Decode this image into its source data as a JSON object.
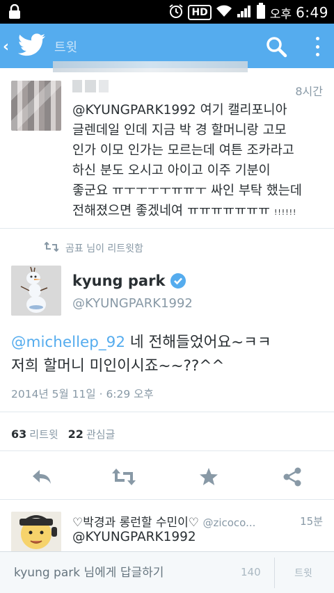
{
  "status_bar": {
    "ampm": "오후",
    "time": "6:49",
    "hd_label": "HD"
  },
  "app_bar": {
    "title": "트윗",
    "icons": [
      "back-arrow-icon",
      "twitter-bird-icon",
      "search-icon",
      "more-vert-icon"
    ],
    "color": "#55acee"
  },
  "tweet1": {
    "time": "8시간",
    "lines": [
      "@KYUNGPARK1992 여기 캘리포니아",
      "글렌데일 인데 지금 박 경 할머니랑 고모",
      "인가 이모 인가는 모르는데 여튼 조카라고",
      "하신 분도 오시고 아이고 이주 기분이",
      "좋군요 ㅠㅜㅜㅜㅜㅠㅠㅜ 싸인 부탁 했는데"
    ],
    "last_line": "전해졌으면 좋겠네여 ㅠㅠㅠㅠㅠㅠㅠ",
    "last_line_suffix": "!!!!!!"
  },
  "retweet_context": {
    "text": "곰표 님이 리트윗함"
  },
  "main_tweet": {
    "name": "kyung park",
    "handle": "@KYUNGPARK1992",
    "mention": "@michellep_92",
    "line1_rest": " 네 전해들었어요~ㅋㅋ",
    "line2": "저희 할머니 미인이시죠~~??^^",
    "date": "2014년 5월 11일 · 6:29 오후",
    "retweet_count": "63",
    "retweet_label": "리트윗",
    "favorite_count": "22",
    "favorite_label": "관심글"
  },
  "tweet3": {
    "name": "♡박경과 롱런할 수민이♡",
    "handle": "@zicoco...",
    "time": "15분",
    "text": "@KYUNGPARK1992"
  },
  "reply_bar": {
    "placeholder": "kyung park 님에게 답글하기",
    "char_count": "140",
    "tweet_button": "트윗"
  },
  "colors": {
    "accent": "#55acee",
    "muted": "#8899a6",
    "text": "#292f33",
    "divider": "#e1e8ed"
  }
}
